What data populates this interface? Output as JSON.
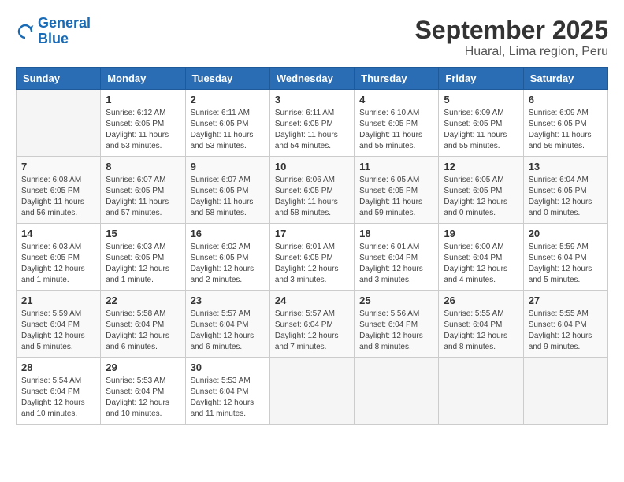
{
  "header": {
    "logo_line1": "General",
    "logo_line2": "Blue",
    "title": "September 2025",
    "subtitle": "Huaral, Lima region, Peru"
  },
  "columns": [
    "Sunday",
    "Monday",
    "Tuesday",
    "Wednesday",
    "Thursday",
    "Friday",
    "Saturday"
  ],
  "weeks": [
    [
      {
        "day": "",
        "info": ""
      },
      {
        "day": "1",
        "info": "Sunrise: 6:12 AM\nSunset: 6:05 PM\nDaylight: 11 hours\nand 53 minutes."
      },
      {
        "day": "2",
        "info": "Sunrise: 6:11 AM\nSunset: 6:05 PM\nDaylight: 11 hours\nand 53 minutes."
      },
      {
        "day": "3",
        "info": "Sunrise: 6:11 AM\nSunset: 6:05 PM\nDaylight: 11 hours\nand 54 minutes."
      },
      {
        "day": "4",
        "info": "Sunrise: 6:10 AM\nSunset: 6:05 PM\nDaylight: 11 hours\nand 55 minutes."
      },
      {
        "day": "5",
        "info": "Sunrise: 6:09 AM\nSunset: 6:05 PM\nDaylight: 11 hours\nand 55 minutes."
      },
      {
        "day": "6",
        "info": "Sunrise: 6:09 AM\nSunset: 6:05 PM\nDaylight: 11 hours\nand 56 minutes."
      }
    ],
    [
      {
        "day": "7",
        "info": "Sunrise: 6:08 AM\nSunset: 6:05 PM\nDaylight: 11 hours\nand 56 minutes."
      },
      {
        "day": "8",
        "info": "Sunrise: 6:07 AM\nSunset: 6:05 PM\nDaylight: 11 hours\nand 57 minutes."
      },
      {
        "day": "9",
        "info": "Sunrise: 6:07 AM\nSunset: 6:05 PM\nDaylight: 11 hours\nand 58 minutes."
      },
      {
        "day": "10",
        "info": "Sunrise: 6:06 AM\nSunset: 6:05 PM\nDaylight: 11 hours\nand 58 minutes."
      },
      {
        "day": "11",
        "info": "Sunrise: 6:05 AM\nSunset: 6:05 PM\nDaylight: 11 hours\nand 59 minutes."
      },
      {
        "day": "12",
        "info": "Sunrise: 6:05 AM\nSunset: 6:05 PM\nDaylight: 12 hours\nand 0 minutes."
      },
      {
        "day": "13",
        "info": "Sunrise: 6:04 AM\nSunset: 6:05 PM\nDaylight: 12 hours\nand 0 minutes."
      }
    ],
    [
      {
        "day": "14",
        "info": "Sunrise: 6:03 AM\nSunset: 6:05 PM\nDaylight: 12 hours\nand 1 minute."
      },
      {
        "day": "15",
        "info": "Sunrise: 6:03 AM\nSunset: 6:05 PM\nDaylight: 12 hours\nand 1 minute."
      },
      {
        "day": "16",
        "info": "Sunrise: 6:02 AM\nSunset: 6:05 PM\nDaylight: 12 hours\nand 2 minutes."
      },
      {
        "day": "17",
        "info": "Sunrise: 6:01 AM\nSunset: 6:05 PM\nDaylight: 12 hours\nand 3 minutes."
      },
      {
        "day": "18",
        "info": "Sunrise: 6:01 AM\nSunset: 6:04 PM\nDaylight: 12 hours\nand 3 minutes."
      },
      {
        "day": "19",
        "info": "Sunrise: 6:00 AM\nSunset: 6:04 PM\nDaylight: 12 hours\nand 4 minutes."
      },
      {
        "day": "20",
        "info": "Sunrise: 5:59 AM\nSunset: 6:04 PM\nDaylight: 12 hours\nand 5 minutes."
      }
    ],
    [
      {
        "day": "21",
        "info": "Sunrise: 5:59 AM\nSunset: 6:04 PM\nDaylight: 12 hours\nand 5 minutes."
      },
      {
        "day": "22",
        "info": "Sunrise: 5:58 AM\nSunset: 6:04 PM\nDaylight: 12 hours\nand 6 minutes."
      },
      {
        "day": "23",
        "info": "Sunrise: 5:57 AM\nSunset: 6:04 PM\nDaylight: 12 hours\nand 6 minutes."
      },
      {
        "day": "24",
        "info": "Sunrise: 5:57 AM\nSunset: 6:04 PM\nDaylight: 12 hours\nand 7 minutes."
      },
      {
        "day": "25",
        "info": "Sunrise: 5:56 AM\nSunset: 6:04 PM\nDaylight: 12 hours\nand 8 minutes."
      },
      {
        "day": "26",
        "info": "Sunrise: 5:55 AM\nSunset: 6:04 PM\nDaylight: 12 hours\nand 8 minutes."
      },
      {
        "day": "27",
        "info": "Sunrise: 5:55 AM\nSunset: 6:04 PM\nDaylight: 12 hours\nand 9 minutes."
      }
    ],
    [
      {
        "day": "28",
        "info": "Sunrise: 5:54 AM\nSunset: 6:04 PM\nDaylight: 12 hours\nand 10 minutes."
      },
      {
        "day": "29",
        "info": "Sunrise: 5:53 AM\nSunset: 6:04 PM\nDaylight: 12 hours\nand 10 minutes."
      },
      {
        "day": "30",
        "info": "Sunrise: 5:53 AM\nSunset: 6:04 PM\nDaylight: 12 hours\nand 11 minutes."
      },
      {
        "day": "",
        "info": ""
      },
      {
        "day": "",
        "info": ""
      },
      {
        "day": "",
        "info": ""
      },
      {
        "day": "",
        "info": ""
      }
    ]
  ]
}
